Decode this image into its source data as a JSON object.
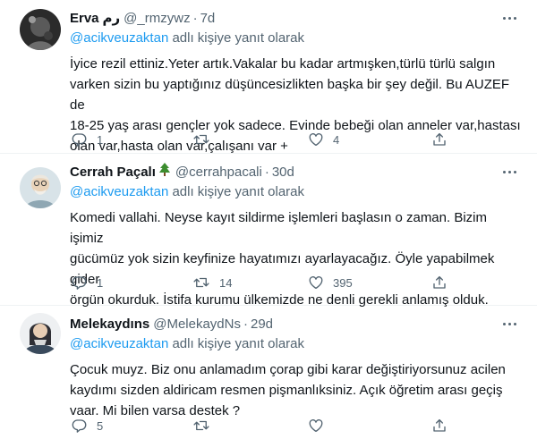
{
  "reply_prefix": "adlı kişiye yanıt olarak",
  "tweets": [
    {
      "name": "Erva",
      "name_suffix": "رم",
      "handle": "@_rmzywz",
      "time": "7d",
      "reply_to": "@acikveuzaktan",
      "lines": [
        "İyice rezil ettiniz.Yeter artık.Vakalar bu kadar artmışken,türlü türlü salgın",
        "varken sizin bu yaptığınız düşüncesizlikten başka bir şey değil. Bu AUZEF de",
        "18-25 yaş arası gençler yok sadece. Evinde bebeği olan anneler var,hastası",
        "olan var,hasta olan var,çalışanı var +"
      ],
      "replies": "1",
      "retweets": "",
      "likes": "4"
    },
    {
      "name": "Cerrah Paçalı",
      "name_emoji": "christmas-tree",
      "handle": "@cerrahpacali",
      "time": "30d",
      "reply_to": "@acikveuzaktan",
      "lines": [
        "Komedi vallahi. Neyse kayıt sildirme işlemleri başlasın o zaman. Bizim işimiz",
        "gücümüz yok sizin keyfinize hayatımızı ayarlayacağız. Öyle yapabilmek gider",
        "örgün okurduk. İstifa kurumu ülkemizde ne denli gerekli anlamış olduk."
      ],
      "replies": "1",
      "retweets": "14",
      "likes": "395"
    },
    {
      "name": "Melekaydıns",
      "handle": "@MelekaydNs",
      "time": "29d",
      "reply_to": "@acikveuzaktan",
      "lines": [
        "Çocuk muyz. Biz onu anlamadım çorap gibi karar değiştiriyorsunuz acilen",
        "kaydımı sizden aldiricam resmen pişmanlıksiniz. Açık öğretim arası geçiş",
        "vaar. Mi bilen varsa destek ?"
      ],
      "replies": "5",
      "retweets": "",
      "likes": ""
    }
  ],
  "colors": {
    "text": "#0f1419",
    "secondary": "#536471",
    "link": "#1d9bf0",
    "divider": "#eff3f4"
  },
  "icons": [
    "reply-icon",
    "retweet-icon",
    "like-icon",
    "share-icon",
    "more-icon",
    "christmas-tree-icon"
  ]
}
